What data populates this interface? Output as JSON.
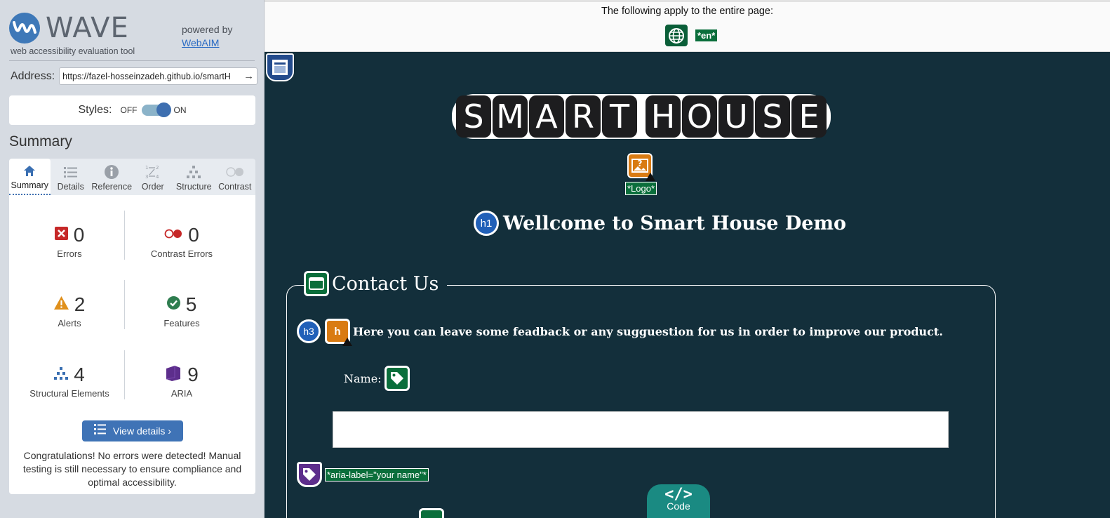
{
  "sidebar": {
    "brand": {
      "name": "WAVE",
      "tagline": "web accessibility evaluation tool"
    },
    "powered_by": "powered by",
    "powered_link": "WebAIM",
    "address": {
      "label": "Address:",
      "value": "https://fazel-hosseinzadeh.github.io/smartH"
    },
    "styles": {
      "label": "Styles:",
      "off": "OFF",
      "on": "ON"
    },
    "summary_title": "Summary",
    "tabs": [
      {
        "label": "Summary",
        "icon": "home-icon"
      },
      {
        "label": "Details",
        "icon": "list-icon"
      },
      {
        "label": "Reference",
        "icon": "info-icon"
      },
      {
        "label": "Order",
        "icon": "order-icon"
      },
      {
        "label": "Structure",
        "icon": "structure-icon"
      },
      {
        "label": "Contrast",
        "icon": "contrast-icon"
      }
    ],
    "stats": {
      "errors": {
        "count": "0",
        "label": "Errors"
      },
      "contrast": {
        "count": "0",
        "label": "Contrast Errors"
      },
      "alerts": {
        "count": "2",
        "label": "Alerts"
      },
      "features": {
        "count": "5",
        "label": "Features"
      },
      "structural": {
        "count": "4",
        "label": "Structural Elements"
      },
      "aria": {
        "count": "9",
        "label": "ARIA"
      }
    },
    "view_details": "View details ›",
    "congrats": "Congratulations! No errors were detected! Manual testing is still necessary to ensure compliance and optimal accessibility."
  },
  "banner": {
    "text": "The following apply to the entire page:",
    "lang_tag": "*en*"
  },
  "site": {
    "logo_letters": [
      "S",
      "M",
      "A",
      "R",
      "T",
      "H",
      "O",
      "U",
      "S",
      "E"
    ],
    "logo_label": "*Logo*",
    "h1_badge": "h1",
    "h1": "Wellcome to Smart House Demo",
    "legend": "Contact Us",
    "h3_badge": "h3",
    "h_alt_badge": "h",
    "h3": "Here you can leave some feadback or any sugguestion for us in order to improve our product.",
    "name_label": "Name:",
    "aria_label": "*aria-label=\"your name\"*",
    "code_symbol": "</>",
    "code_label": "Code"
  },
  "colors": {
    "site_bg": "#132f3b",
    "feature_green": "#0a6e3b",
    "alert_orange": "#d97b12",
    "structure_blue": "#2160b8",
    "aria_purple": "#5d2e8c",
    "wave_blue": "#3e78b8"
  }
}
